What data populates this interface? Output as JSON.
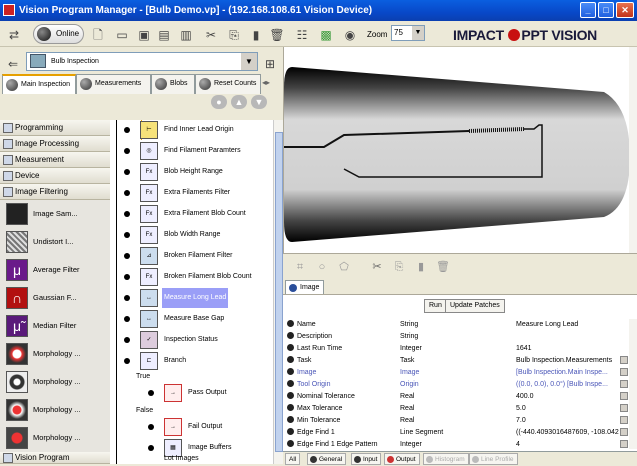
{
  "window": {
    "title": "Vision Program Manager - [Bulb Demo.vp] - (192.168.108.61 Vision Device)",
    "minimize": "_",
    "maximize": "□",
    "close": "✕"
  },
  "toolbar": {
    "online_label": "Online",
    "zoom_label": "Zoom",
    "zoom_value": "75",
    "brand": "IMPACT",
    "brand_suffix": "PPT VISION"
  },
  "left": {
    "inspection_select": "Bulb Inspection",
    "tabs": [
      "Main Inspection",
      "Measurements",
      "Blobs",
      "Reset Counts"
    ],
    "categories": [
      "Programming",
      "Image Processing",
      "Measurement",
      "Device",
      "Image Filtering"
    ],
    "filter_items": [
      "Image Sam...",
      "Undistort I...",
      "Average Filter",
      "Gaussian F...",
      "Median Filter",
      "Morphology ...",
      "Morphology ...",
      "Morphology ...",
      "Morphology ..."
    ],
    "bottom_category": "Vision Program"
  },
  "tree": {
    "nodes": [
      {
        "label": "Find Inner Lead Origin",
        "icon": "edge-icon"
      },
      {
        "label": "Find Filament Paramters",
        "icon": "target-icon"
      },
      {
        "label": "Blob Height Range",
        "icon": "fx-icon"
      },
      {
        "label": "Extra Filaments Filter",
        "icon": "fx-icon"
      },
      {
        "label": "Extra Filament Blob Count",
        "icon": "fx-icon"
      },
      {
        "label": "Blob Width Range",
        "icon": "fx-icon"
      },
      {
        "label": "Broken Filament Filter",
        "icon": "filter-icon"
      },
      {
        "label": "Broken Filament Blob Count",
        "icon": "fx-icon"
      },
      {
        "label": "Measure Long Lead",
        "icon": "measure-icon"
      },
      {
        "label": "Measure Base Gap",
        "icon": "measure-icon"
      },
      {
        "label": "Inspection Status",
        "icon": "status-icon"
      },
      {
        "label": "Branch",
        "icon": "branch-icon"
      }
    ],
    "true_label": "True",
    "pass_output": "Pass Output",
    "false_label": "False",
    "fail_output": "Fail Output",
    "image_buffers": "Image Buffers",
    "lot_images": "Lot Images"
  },
  "image_tab": "Image",
  "props": {
    "run_label": "Run",
    "update_label": "Update Patches",
    "rows": [
      {
        "name": "Name",
        "type": "String",
        "value": "Measure Long Lead",
        "blue": false
      },
      {
        "name": "Description",
        "type": "String",
        "value": "",
        "blue": false
      },
      {
        "name": "Last Run Time",
        "type": "Integer",
        "value": "1641",
        "blue": false
      },
      {
        "name": "Task",
        "type": "Task",
        "value": "Bulb Inspection.Measurements",
        "blue": false
      },
      {
        "name": "Image",
        "type": "Image",
        "value": "[Bulb Inspection.Main Inspe...",
        "blue": true
      },
      {
        "name": "Tool Origin",
        "type": "Origin",
        "value": "((0.0, 0.0), 0.0°) [Bulb Inspe...",
        "blue": true
      },
      {
        "name": "Nominal Tolerance",
        "type": "Real",
        "value": "400.0",
        "blue": false
      },
      {
        "name": "Max Tolerance",
        "type": "Real",
        "value": "5.0",
        "blue": false
      },
      {
        "name": "Min Tolerance",
        "type": "Real",
        "value": "7.0",
        "blue": false
      },
      {
        "name": "Edge Find 1",
        "type": "Line Segment",
        "value": "((-440.4093016487609, -108.042",
        "blue": false
      },
      {
        "name": "Edge Find 1 Edge Pattern",
        "type": "Integer",
        "value": "4",
        "blue": false
      }
    ],
    "bottom_tabs": [
      "All",
      "General",
      "Input",
      "Output",
      "Histogram",
      "Line Profile"
    ]
  }
}
